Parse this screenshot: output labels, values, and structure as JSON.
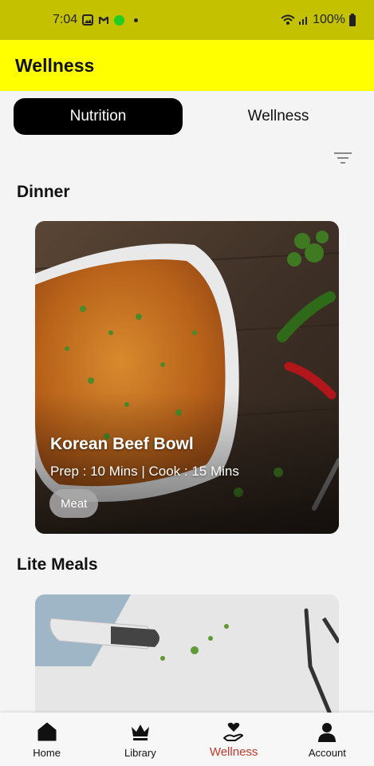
{
  "status_bar": {
    "time": "7:04",
    "battery": "100%",
    "icons": [
      "image-icon",
      "gmail-icon",
      "green-dot-indicator",
      "wifi-icon",
      "signal-icon",
      "battery-icon"
    ]
  },
  "app_bar": {
    "title": "Wellness"
  },
  "tabs": [
    {
      "label": "Nutrition",
      "active": true
    },
    {
      "label": "Wellness",
      "active": false
    }
  ],
  "filter": {
    "icon": "filter-icon"
  },
  "sections": [
    {
      "title": "Dinner",
      "cards": [
        {
          "name": "Korean Beef Bowl",
          "prep": "Prep : 10 Mins",
          "cook": "| Cook :  15 Mins",
          "tag": "Meat"
        }
      ]
    },
    {
      "title": "Lite Meals"
    }
  ],
  "bottom_nav": [
    {
      "label": "Home",
      "icon": "home-icon",
      "active": false
    },
    {
      "label": "Library",
      "icon": "crown-icon",
      "active": false
    },
    {
      "label": "Wellness",
      "icon": "heart-hand-icon",
      "active": true
    },
    {
      "label": "Account",
      "icon": "person-icon",
      "active": false
    }
  ],
  "colors": {
    "status_bar": "#c4c200",
    "app_bar": "#ffff00",
    "active_tab": "#000000",
    "active_nav": "#c0392b",
    "background": "#f4f4f4"
  }
}
